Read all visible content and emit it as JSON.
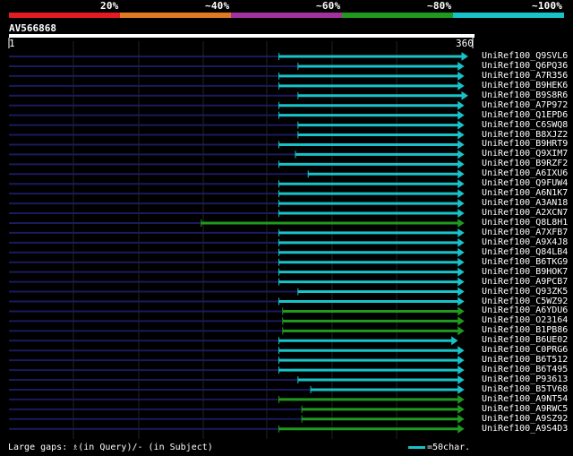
{
  "identity_scale": {
    "labels": [
      "20%",
      "~40%",
      "~60%",
      "~80%",
      "~100%"
    ],
    "colors": [
      "#e31b23",
      "#e07b22",
      "#a032a0",
      "#1f9a1f",
      "#17c3c9"
    ]
  },
  "query": {
    "id": "AV566868",
    "start_label": "1",
    "end_label": "360",
    "length": 360
  },
  "chart_data": {
    "type": "alignment",
    "query_length": 360,
    "hits": [
      {
        "name": "UniRef100_Q9SVL6",
        "start": 0,
        "end": 360,
        "color": "#17c3c9"
      },
      {
        "name": "UniRef100_Q6PQ36",
        "start": 0,
        "end": 357,
        "color": "#17c3c9"
      },
      {
        "name": "UniRef100_A7R356",
        "start": 0,
        "end": 357,
        "color": "#17c3c9"
      },
      {
        "name": "UniRef100_B9HEK6",
        "start": 0,
        "end": 357,
        "color": "#17c3c9"
      },
      {
        "name": "UniRef100_B9S8R6",
        "start": 0,
        "end": 360,
        "color": "#17c3c9"
      },
      {
        "name": "UniRef100_A7P972",
        "start": 0,
        "end": 357,
        "color": "#17c3c9"
      },
      {
        "name": "UniRef100_Q1EPD6",
        "start": 0,
        "end": 357,
        "color": "#17c3c9"
      },
      {
        "name": "UniRef100_C6SWQ8",
        "start": 0,
        "end": 357,
        "color": "#17c3c9"
      },
      {
        "name": "UniRef100_B8XJZ2",
        "start": 0,
        "end": 357,
        "color": "#17c3c9"
      },
      {
        "name": "UniRef100_B9HRT9",
        "start": 0,
        "end": 357,
        "color": "#17c3c9"
      },
      {
        "name": "UniRef100_Q9XIM7",
        "start": 0,
        "end": 357,
        "color": "#17c3c9"
      },
      {
        "name": "UniRef100_B9RZF2",
        "start": 0,
        "end": 357,
        "color": "#17c3c9"
      },
      {
        "name": "UniRef100_A6IXU6",
        "start": 0,
        "end": 357,
        "color": "#17c3c9"
      },
      {
        "name": "UniRef100_Q9FUW4",
        "start": 0,
        "end": 357,
        "color": "#17c3c9"
      },
      {
        "name": "UniRef100_A6N1K7",
        "start": 0,
        "end": 357,
        "color": "#17c3c9"
      },
      {
        "name": "UniRef100_A3AN18",
        "start": 0,
        "end": 357,
        "color": "#17c3c9"
      },
      {
        "name": "UniRef100_A2XCN7",
        "start": 0,
        "end": 357,
        "color": "#17c3c9"
      },
      {
        "name": "UniRef100_Q8L8H1",
        "start": 0,
        "end": 357,
        "color": "#1f9a1f"
      },
      {
        "name": "UniRef100_A7XFB7",
        "start": 0,
        "end": 357,
        "color": "#17c3c9"
      },
      {
        "name": "UniRef100_A9X4J8",
        "start": 0,
        "end": 357,
        "color": "#17c3c9"
      },
      {
        "name": "UniRef100_Q84LB4",
        "start": 0,
        "end": 357,
        "color": "#17c3c9"
      },
      {
        "name": "UniRef100_B6TKG9",
        "start": 0,
        "end": 357,
        "color": "#17c3c9"
      },
      {
        "name": "UniRef100_B9HOK7",
        "start": 0,
        "end": 357,
        "color": "#17c3c9"
      },
      {
        "name": "UniRef100_A9PCB7",
        "start": 0,
        "end": 357,
        "color": "#17c3c9"
      },
      {
        "name": "UniRef100_Q93ZK5",
        "start": 0,
        "end": 357,
        "color": "#17c3c9"
      },
      {
        "name": "UniRef100_C5WZ92",
        "start": 0,
        "end": 357,
        "color": "#17c3c9"
      },
      {
        "name": "UniRef100_A6YDU6",
        "start": 0,
        "end": 357,
        "color": "#1f9a1f"
      },
      {
        "name": "UniRef100_O23164",
        "start": 0,
        "end": 357,
        "color": "#1f9a1f"
      },
      {
        "name": "UniRef100_B1PB86",
        "start": 0,
        "end": 357,
        "color": "#1f9a1f"
      },
      {
        "name": "UniRef100_B6UE02",
        "start": 0,
        "end": 352,
        "color": "#17c3c9"
      },
      {
        "name": "UniRef100_C0PRG6",
        "start": 0,
        "end": 357,
        "color": "#17c3c9"
      },
      {
        "name": "UniRef100_B6T512",
        "start": 0,
        "end": 357,
        "color": "#17c3c9"
      },
      {
        "name": "UniRef100_B6T495",
        "start": 0,
        "end": 357,
        "color": "#17c3c9"
      },
      {
        "name": "UniRef100_P93613",
        "start": 0,
        "end": 357,
        "color": "#17c3c9"
      },
      {
        "name": "UniRef100_B5TV68",
        "start": 0,
        "end": 357,
        "color": "#17c3c9"
      },
      {
        "name": "UniRef100_A9NT54",
        "start": 0,
        "end": 357,
        "color": "#1f9a1f"
      },
      {
        "name": "UniRef100_A9RWC5",
        "start": 0,
        "end": 357,
        "color": "#1f9a1f"
      },
      {
        "name": "UniRef100_A9SZ92",
        "start": 0,
        "end": 357,
        "color": "#1f9a1f"
      },
      {
        "name": "UniRef100_A9S4D3",
        "start": 0,
        "end": 357,
        "color": "#1f9a1f"
      }
    ],
    "aligned_from": [
      212,
      227,
      212,
      212,
      227,
      212,
      212,
      227,
      227,
      212,
      225,
      212,
      235,
      212,
      212,
      212,
      212,
      151,
      212,
      212,
      212,
      212,
      212,
      212,
      227,
      212,
      215,
      215,
      215,
      212,
      212,
      212,
      212,
      227,
      237,
      212,
      230,
      230,
      212
    ]
  },
  "footer": {
    "gaps_text": "Large gaps: ♗(in Query)/- (in Subject)",
    "scale_text": "=50char."
  }
}
